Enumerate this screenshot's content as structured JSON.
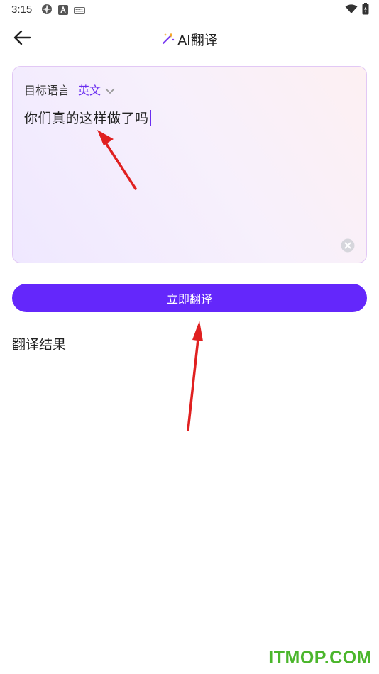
{
  "status_bar": {
    "time": "3:15",
    "left_icons": [
      "aperture-icon",
      "a-badge-icon",
      "keyboard-icon"
    ],
    "right_icons": [
      "wifi-icon",
      "battery-icon"
    ]
  },
  "header": {
    "title": "AI翻译",
    "back_icon": "back-arrow-icon",
    "title_icon": "magic-wand-icon"
  },
  "input_card": {
    "target_language_label": "目标语言",
    "target_language_value": "英文",
    "input_text": "你们真的这样做了吗",
    "clear_icon": "clear-icon"
  },
  "translate_button": {
    "label": "立即翻译"
  },
  "result": {
    "title": "翻译结果"
  },
  "watermark": {
    "text": "ITMOP.COM"
  },
  "colors": {
    "accent": "#6427fb",
    "language_text": "#6a2ef0",
    "annotation_arrow": "#e02020",
    "watermark": "#4bb62c"
  }
}
